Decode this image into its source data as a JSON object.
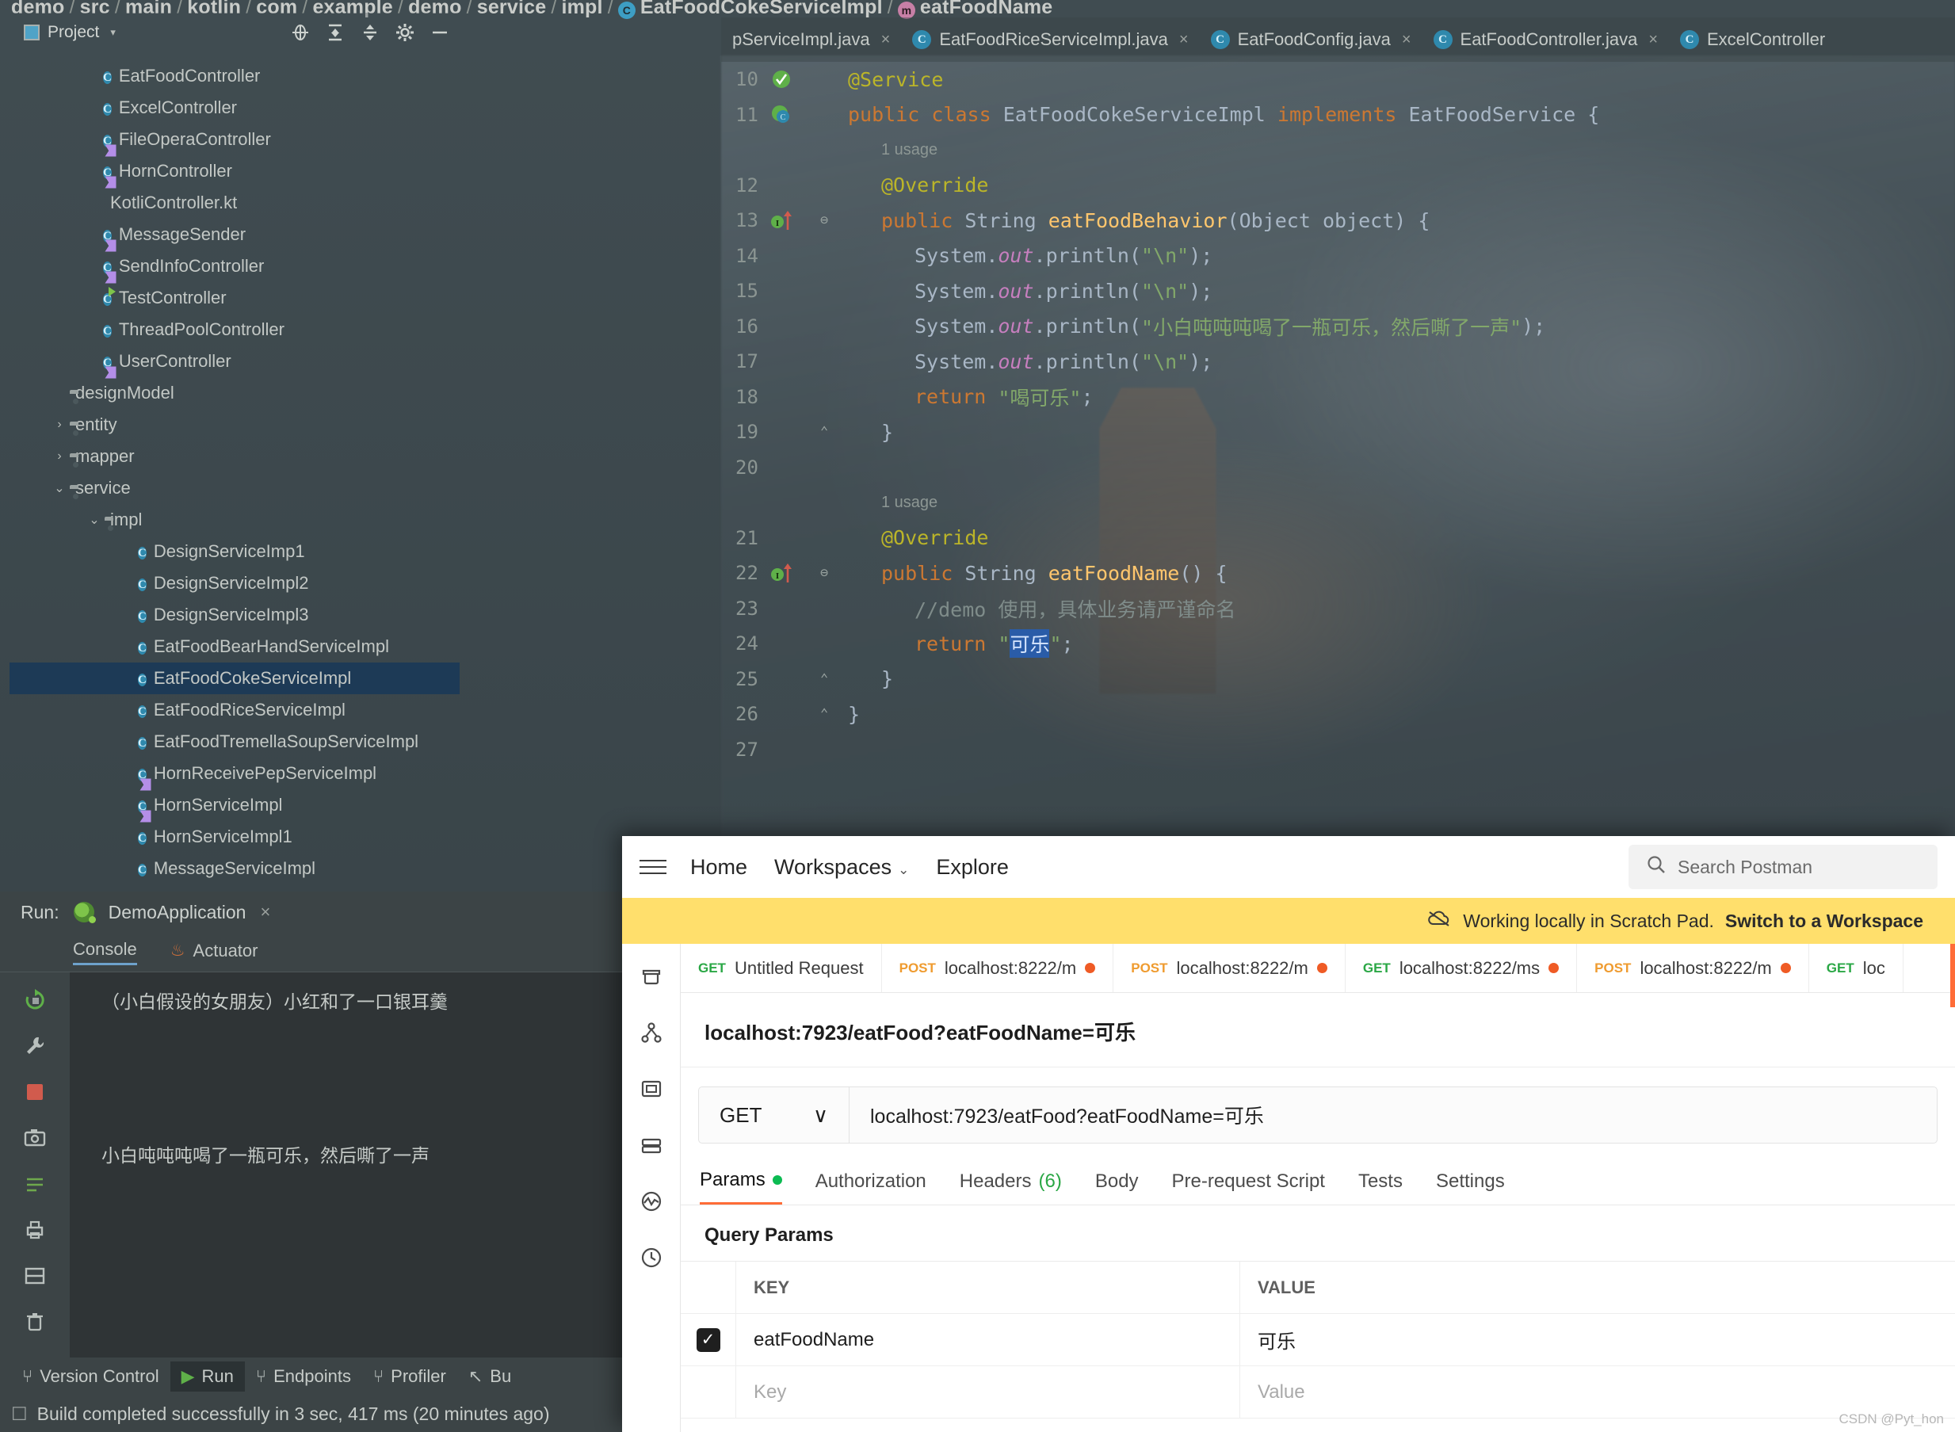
{
  "ide": {
    "breadcrumb": [
      "demo",
      "src",
      "main",
      "kotlin",
      "com",
      "example",
      "demo",
      "service",
      "impl",
      "EatFoodCokeServiceImpl",
      "eatFoodName"
    ],
    "project_panel": {
      "title": "Project",
      "caret": "▾",
      "icons": [
        "locate-icon",
        "expand-all-icon",
        "collapse-all-icon",
        "settings-icon",
        "hide-icon"
      ]
    },
    "tree": [
      {
        "label": "EatFoodController",
        "icon": "class-icon",
        "indent": 3,
        "chev": "",
        "selected": false
      },
      {
        "label": "ExcelController",
        "icon": "class-icon",
        "indent": 3,
        "chev": "",
        "selected": false
      },
      {
        "label": "FileOperaController",
        "icon": "class-icon-flag",
        "indent": 3,
        "chev": "",
        "selected": false
      },
      {
        "label": "HornController",
        "icon": "class-icon-flag",
        "indent": 3,
        "chev": "",
        "selected": false
      },
      {
        "label": "KotliController.kt",
        "icon": "kotlin-icon",
        "indent": 3,
        "chev": "",
        "selected": false
      },
      {
        "label": "MessageSender",
        "icon": "class-icon-flag",
        "indent": 3,
        "chev": "",
        "selected": false
      },
      {
        "label": "SendInfoController",
        "icon": "class-icon-flag",
        "indent": 3,
        "chev": "",
        "selected": false
      },
      {
        "label": "TestController",
        "icon": "class-icon-run",
        "indent": 3,
        "chev": "",
        "selected": false
      },
      {
        "label": "ThreadPoolController",
        "icon": "class-icon",
        "indent": 3,
        "chev": "",
        "selected": false
      },
      {
        "label": "UserController",
        "icon": "class-icon-flag",
        "indent": 3,
        "chev": "",
        "selected": false
      },
      {
        "label": "designModel",
        "icon": "folder-icon",
        "indent": 2,
        "chev": "",
        "selected": false
      },
      {
        "label": "entity",
        "icon": "folder-icon",
        "indent": 2,
        "chev": "›",
        "selected": false
      },
      {
        "label": "mapper",
        "icon": "folder-icon",
        "indent": 2,
        "chev": "›",
        "selected": false
      },
      {
        "label": "service",
        "icon": "folder-icon",
        "indent": 2,
        "chev": "⌄",
        "selected": false
      },
      {
        "label": "impl",
        "icon": "folder-icon",
        "indent": 3,
        "chev": "⌄",
        "selected": false
      },
      {
        "label": "DesignServiceImp1",
        "icon": "class-icon",
        "indent": 4,
        "chev": "",
        "selected": false
      },
      {
        "label": "DesignServiceImpl2",
        "icon": "class-icon",
        "indent": 4,
        "chev": "",
        "selected": false
      },
      {
        "label": "DesignServiceImpl3",
        "icon": "class-icon",
        "indent": 4,
        "chev": "",
        "selected": false
      },
      {
        "label": "EatFoodBearHandServiceImpl",
        "icon": "class-icon",
        "indent": 4,
        "chev": "",
        "selected": false
      },
      {
        "label": "EatFoodCokeServiceImpl",
        "icon": "class-icon",
        "indent": 4,
        "chev": "",
        "selected": true
      },
      {
        "label": "EatFoodRiceServiceImpl",
        "icon": "class-icon",
        "indent": 4,
        "chev": "",
        "selected": false
      },
      {
        "label": "EatFoodTremellaSoupServiceImpl",
        "icon": "class-icon",
        "indent": 4,
        "chev": "",
        "selected": false
      },
      {
        "label": "HornReceivePepServiceImpl",
        "icon": "class-icon-flag",
        "indent": 4,
        "chev": "",
        "selected": false
      },
      {
        "label": "HornServiceImpl",
        "icon": "class-icon-flag",
        "indent": 4,
        "chev": "",
        "selected": false
      },
      {
        "label": "HornServiceImpl1",
        "icon": "class-icon",
        "indent": 4,
        "chev": "",
        "selected": false
      },
      {
        "label": "MessageServiceImpl",
        "icon": "class-icon",
        "indent": 4,
        "chev": "",
        "selected": false
      }
    ],
    "editor_tabs": [
      {
        "label": "pServiceImpl.java",
        "icon": "",
        "close": "×"
      },
      {
        "label": "EatFoodRiceServiceImpl.java",
        "icon": "class-icon",
        "close": "×"
      },
      {
        "label": "EatFoodConfig.java",
        "icon": "class-icon",
        "close": "×"
      },
      {
        "label": "EatFoodController.java",
        "icon": "class-icon",
        "close": "×"
      },
      {
        "label": "ExcelController",
        "icon": "class-icon",
        "close": ""
      }
    ],
    "code_lines": [
      {
        "no": "10",
        "gutter": "run-check-icon",
        "text": "@Service",
        "kind": "anno"
      },
      {
        "no": "11",
        "gutter": "run-class-icon",
        "text": "public class EatFoodCokeServiceImpl implements EatFoodService {",
        "kind": "decl"
      },
      {
        "no": "",
        "gutter": "",
        "text": "1 usage",
        "kind": "usage"
      },
      {
        "no": "12",
        "gutter": "",
        "text": "@Override",
        "kind": "anno"
      },
      {
        "no": "13",
        "gutter": "impl-arrow-icon",
        "text": "public String eatFoodBehavior(Object object) {",
        "kind": "method"
      },
      {
        "no": "14",
        "gutter": "",
        "text": "System.out.println(\"\\n\");",
        "kind": "print-n"
      },
      {
        "no": "15",
        "gutter": "",
        "text": "System.out.println(\"\\n\");",
        "kind": "print-n"
      },
      {
        "no": "16",
        "gutter": "",
        "text": "System.out.println(\"小白吨吨吨喝了一瓶可乐，然后嘶了一声\");",
        "kind": "print-cn"
      },
      {
        "no": "17",
        "gutter": "",
        "text": "System.out.println(\"\\n\");",
        "kind": "print-n"
      },
      {
        "no": "18",
        "gutter": "",
        "text": "return \"喝可乐\";",
        "kind": "return-cn"
      },
      {
        "no": "19",
        "gutter": "",
        "text": "}",
        "kind": "brace"
      },
      {
        "no": "20",
        "gutter": "",
        "text": "",
        "kind": "blank"
      },
      {
        "no": "",
        "gutter": "",
        "text": "1 usage",
        "kind": "usage"
      },
      {
        "no": "21",
        "gutter": "",
        "text": "@Override",
        "kind": "anno"
      },
      {
        "no": "22",
        "gutter": "impl-arrow-icon",
        "text": "public String eatFoodName() {",
        "kind": "method2"
      },
      {
        "no": "23",
        "gutter": "",
        "text": "//demo 使用，具体业务请严谨命名",
        "kind": "comment"
      },
      {
        "no": "24",
        "gutter": "",
        "text": "return \"可乐\";",
        "kind": "return-hl"
      },
      {
        "no": "25",
        "gutter": "",
        "text": "}",
        "kind": "brace"
      },
      {
        "no": "26",
        "gutter": "",
        "text": "}",
        "kind": "brace0"
      },
      {
        "no": "27",
        "gutter": "",
        "text": "",
        "kind": "blank"
      }
    ],
    "code_tokens": {
      "annotation_service": "@Service",
      "annotation_override": "@Override",
      "usage_label": "1 usage",
      "kw_public": "public",
      "kw_class": "class",
      "kw_implements": "implements",
      "kw_return": "return",
      "type_string": "String",
      "type_object": "Object",
      "class_name": "EatFoodCokeServiceImpl",
      "interface_name": "EatFoodService",
      "method1": "eatFoodBehavior",
      "method2": "eatFoodName",
      "param_object": "object",
      "system": "System",
      "out": "out",
      "println": "println",
      "str_newline": "\"\\n\"",
      "str_chinese_long": "\"小白吨吨吨喝了一瓶可乐，然后嘶了一声\"",
      "str_drink_coke": "\"喝可乐\"",
      "str_coke": "可乐",
      "comment_demo": "//demo 使用，具体业务请严谨命名"
    },
    "run_window": {
      "label": "Run:",
      "config_name": "DemoApplication",
      "close": "×",
      "tabs": [
        {
          "label": "Console",
          "active": true
        },
        {
          "label": "Actuator",
          "active": false
        }
      ],
      "console_lines": [
        "（小白假设的女朋友）小红和了一口银耳羹",
        "",
        "小白吨吨吨喝了一瓶可乐，然后嘶了一声"
      ],
      "toolbar_icons": [
        "rerun-icon",
        "wrench-icon",
        "stop-icon",
        "camera-icon",
        "thread-dump-icon",
        "print-icon",
        "layout-icon",
        "trash-icon",
        "pin-icon"
      ],
      "scroll_icons": [
        "scroll-up-icon",
        "scroll-down-icon",
        "soft-wrap-icon",
        "scroll-to-end-icon"
      ]
    },
    "status_tabs": [
      {
        "label": "Version Control",
        "icon": "branch-icon",
        "active": false
      },
      {
        "label": "Run",
        "icon": "run-icon",
        "active": true
      },
      {
        "label": "Endpoints",
        "icon": "endpoints-icon",
        "active": false
      },
      {
        "label": "Profiler",
        "icon": "profiler-icon",
        "active": false
      },
      {
        "label": "Bu",
        "icon": "build-icon",
        "active": false
      }
    ],
    "build_status": "Build completed successfully in 3 sec, 417 ms (20 minutes ago)"
  },
  "postman": {
    "nav": {
      "menu_icon": "hamburger-icon",
      "items": [
        "Home",
        "Workspaces",
        "Explore"
      ],
      "workspaces_caret": "⌄"
    },
    "search": {
      "placeholder": "Search Postman",
      "icon": "search-icon"
    },
    "banner": {
      "icon": "cloud-off-icon",
      "text": "Working locally in Scratch Pad.",
      "action": "Switch to a Workspace"
    },
    "rail_icons": [
      "collections-icon",
      "apis-icon",
      "environments-icon",
      "mock-servers-icon",
      "monitors-icon",
      "history-icon"
    ],
    "request_tabs": [
      {
        "method": "GET",
        "label": "Untitled Request",
        "dirty": false
      },
      {
        "method": "POST",
        "label": "localhost:8222/m",
        "dirty": true
      },
      {
        "method": "POST",
        "label": "localhost:8222/m",
        "dirty": true
      },
      {
        "method": "GET",
        "label": "localhost:8222/ms",
        "dirty": true
      },
      {
        "method": "POST",
        "label": "localhost:8222/m",
        "dirty": true
      },
      {
        "method": "GET",
        "label": "loc",
        "dirty": false
      }
    ],
    "request_title": "localhost:7923/eatFood?eatFoodName=可乐",
    "method": "GET",
    "method_caret": "∨",
    "url": "localhost:7923/eatFood?eatFoodName=可乐",
    "sub_tabs": [
      {
        "label": "Params",
        "badge": "dot",
        "active": true
      },
      {
        "label": "Authorization",
        "badge": "",
        "active": false
      },
      {
        "label": "Headers",
        "badge": "(6)",
        "active": false
      },
      {
        "label": "Body",
        "badge": "",
        "active": false
      },
      {
        "label": "Pre-request Script",
        "badge": "",
        "active": false
      },
      {
        "label": "Tests",
        "badge": "",
        "active": false
      },
      {
        "label": "Settings",
        "badge": "",
        "active": false
      }
    ],
    "query_params": {
      "title": "Query Params",
      "headers": {
        "key": "KEY",
        "value": "VALUE"
      },
      "rows": [
        {
          "checked": true,
          "key": "eatFoodName",
          "value": "可乐"
        },
        {
          "checked": false,
          "key": "Key",
          "value": "Value",
          "placeholder": true
        }
      ]
    },
    "watermark": "CSDN @Pyt_hon"
  },
  "colors": {
    "accent_orange": "#ff6c37",
    "banner_yellow": "#ffdf6c",
    "selection_blue": "#1d3a56",
    "ide_bg": "#3c4648"
  }
}
